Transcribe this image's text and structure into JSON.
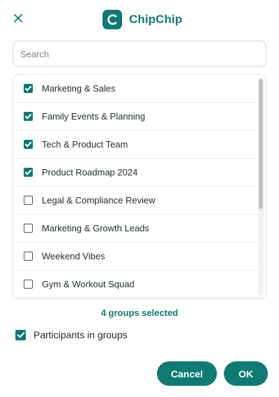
{
  "header": {
    "close_icon": "close-icon",
    "brand_name": "ChipChip",
    "logo_icon": "chipchip-logo-icon",
    "brand_color": "#0d7a73"
  },
  "search": {
    "placeholder": "Search",
    "value": ""
  },
  "groups": [
    {
      "label": "Marketing & Sales",
      "checked": true
    },
    {
      "label": "Family Events & Planning",
      "checked": true
    },
    {
      "label": "Tech & Product Team",
      "checked": true
    },
    {
      "label": "Product Roadmap 2024",
      "checked": true
    },
    {
      "label": "Legal & Compliance Review",
      "checked": false
    },
    {
      "label": "Marketing & Growth Leads",
      "checked": false
    },
    {
      "label": "Weekend Vibes",
      "checked": false
    },
    {
      "label": "Gym & Workout Squad",
      "checked": false
    }
  ],
  "selection_summary": "4 groups selected",
  "participants_option": {
    "label": "Participants in groups",
    "checked": true
  },
  "actions": {
    "cancel_label": "Cancel",
    "ok_label": "OK"
  }
}
